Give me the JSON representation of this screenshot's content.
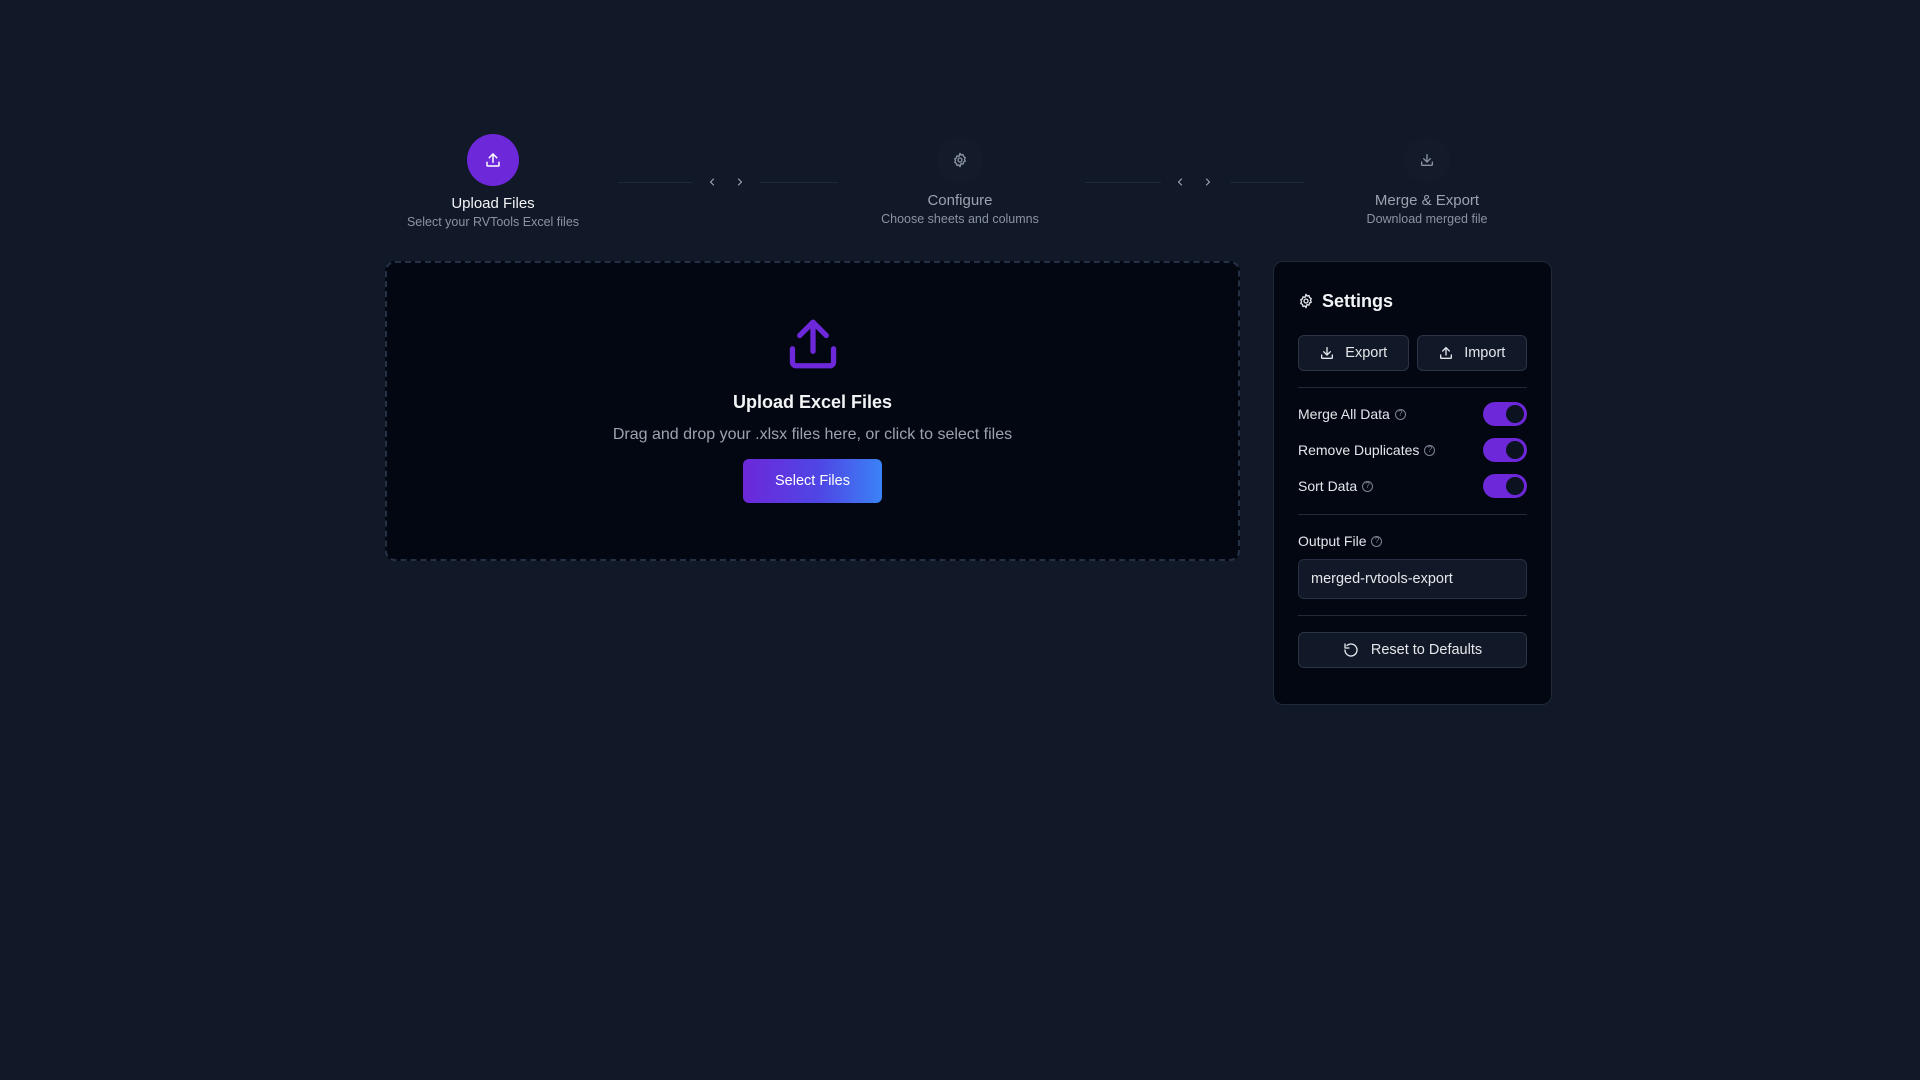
{
  "stepper": {
    "steps": [
      {
        "title": "Upload Files",
        "subtitle": "Select your RVTools Excel files",
        "icon": "upload-icon",
        "state": "active"
      },
      {
        "title": "Configure",
        "subtitle": "Choose sheets and columns",
        "icon": "gear-icon",
        "state": "inactive"
      },
      {
        "title": "Merge & Export",
        "subtitle": "Download merged file",
        "icon": "download-icon",
        "state": "inactive"
      }
    ]
  },
  "dropzone": {
    "icon": "upload-icon",
    "title": "Upload Excel Files",
    "description": "Drag and drop your .xlsx files here, or click to select files",
    "button_label": "Select Files"
  },
  "settings": {
    "title": "Settings",
    "export_label": "Export",
    "import_label": "Import",
    "toggles": [
      {
        "label": "Merge All Data",
        "enabled": true
      },
      {
        "label": "Remove Duplicates",
        "enabled": true
      },
      {
        "label": "Sort Data",
        "enabled": true
      }
    ],
    "output_label": "Output File",
    "output_value": "merged-rvtools-export",
    "reset_label": "Reset to Defaults"
  },
  "colors": {
    "background": "#111827",
    "panel": "#030712",
    "accent": "#6d28d9",
    "accent_gradient_end": "#3b82f6"
  }
}
